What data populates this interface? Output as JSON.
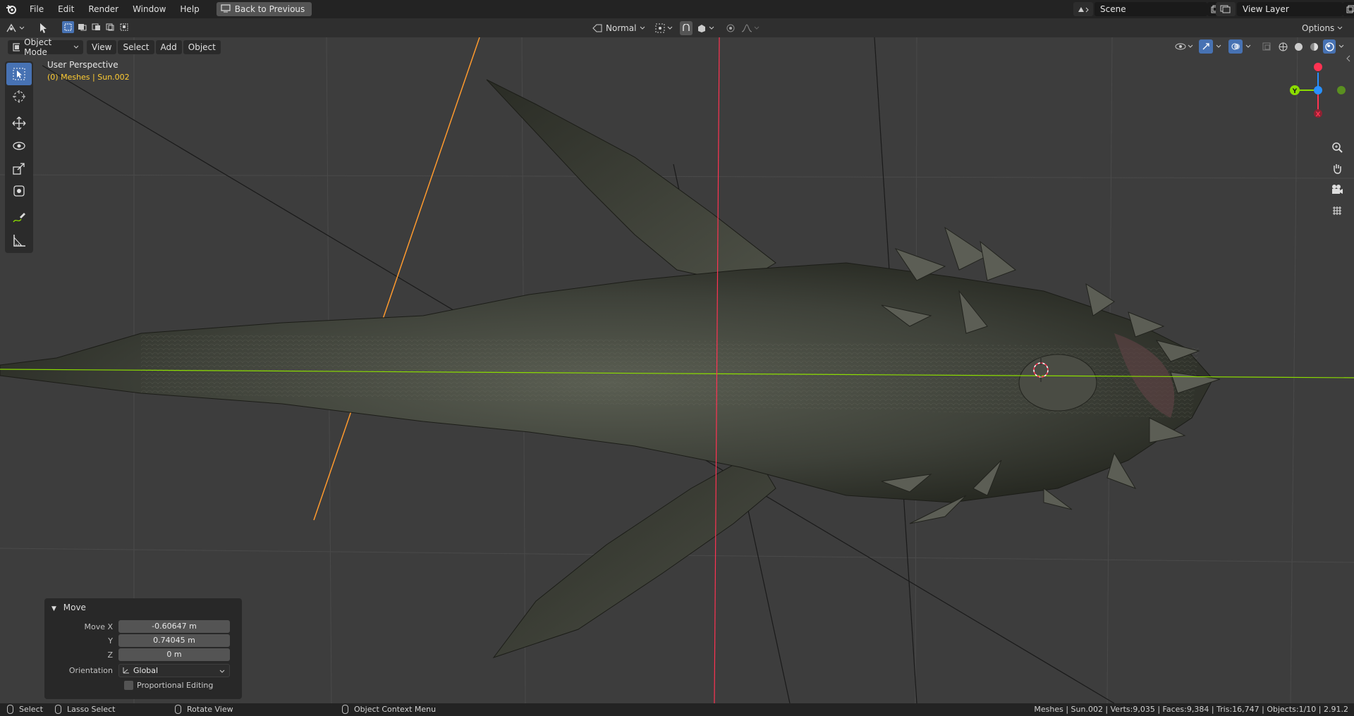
{
  "topbar": {
    "menus": [
      "File",
      "Edit",
      "Render",
      "Window",
      "Help"
    ],
    "back_button": "Back to Previous",
    "scene_name": "Scene",
    "view_layer": "View Layer"
  },
  "header": {
    "shading_mode": "Normal",
    "options_label": "Options"
  },
  "viewport_header": {
    "mode": "Object Mode",
    "menus": [
      "View",
      "Select",
      "Add",
      "Object"
    ]
  },
  "overlay": {
    "perspective": "User Perspective",
    "collection_info": "(0) Meshes | Sun.002"
  },
  "move_panel": {
    "title": "Move",
    "labels": {
      "x": "Move X",
      "y": "Y",
      "z": "Z",
      "orientation": "Orientation"
    },
    "values": {
      "x": "-0.60647 m",
      "y": "0.74045 m",
      "z": "0 m"
    },
    "orientation": "Global",
    "proportional_editing": "Proportional Editing"
  },
  "statusbar": {
    "select": "Select",
    "lasso": "Lasso Select",
    "rotate": "Rotate View",
    "context": "Object Context Menu",
    "stats": "Meshes | Sun.002 | Verts:9,035 | Faces:9,384 | Tris:16,747 | Objects:1/10 | 2.91.2"
  },
  "colors": {
    "x_axis": "#ff3352",
    "y_axis": "#8bdc00",
    "z_axis": "#2890ff",
    "active_tool": "#4772b3",
    "light_line": "#ff9a2e"
  },
  "icons": {
    "logo": "blender-logo-icon",
    "nav": [
      "zoom-icon",
      "pan-hand-icon",
      "camera-icon",
      "grid-ortho-icon"
    ]
  }
}
